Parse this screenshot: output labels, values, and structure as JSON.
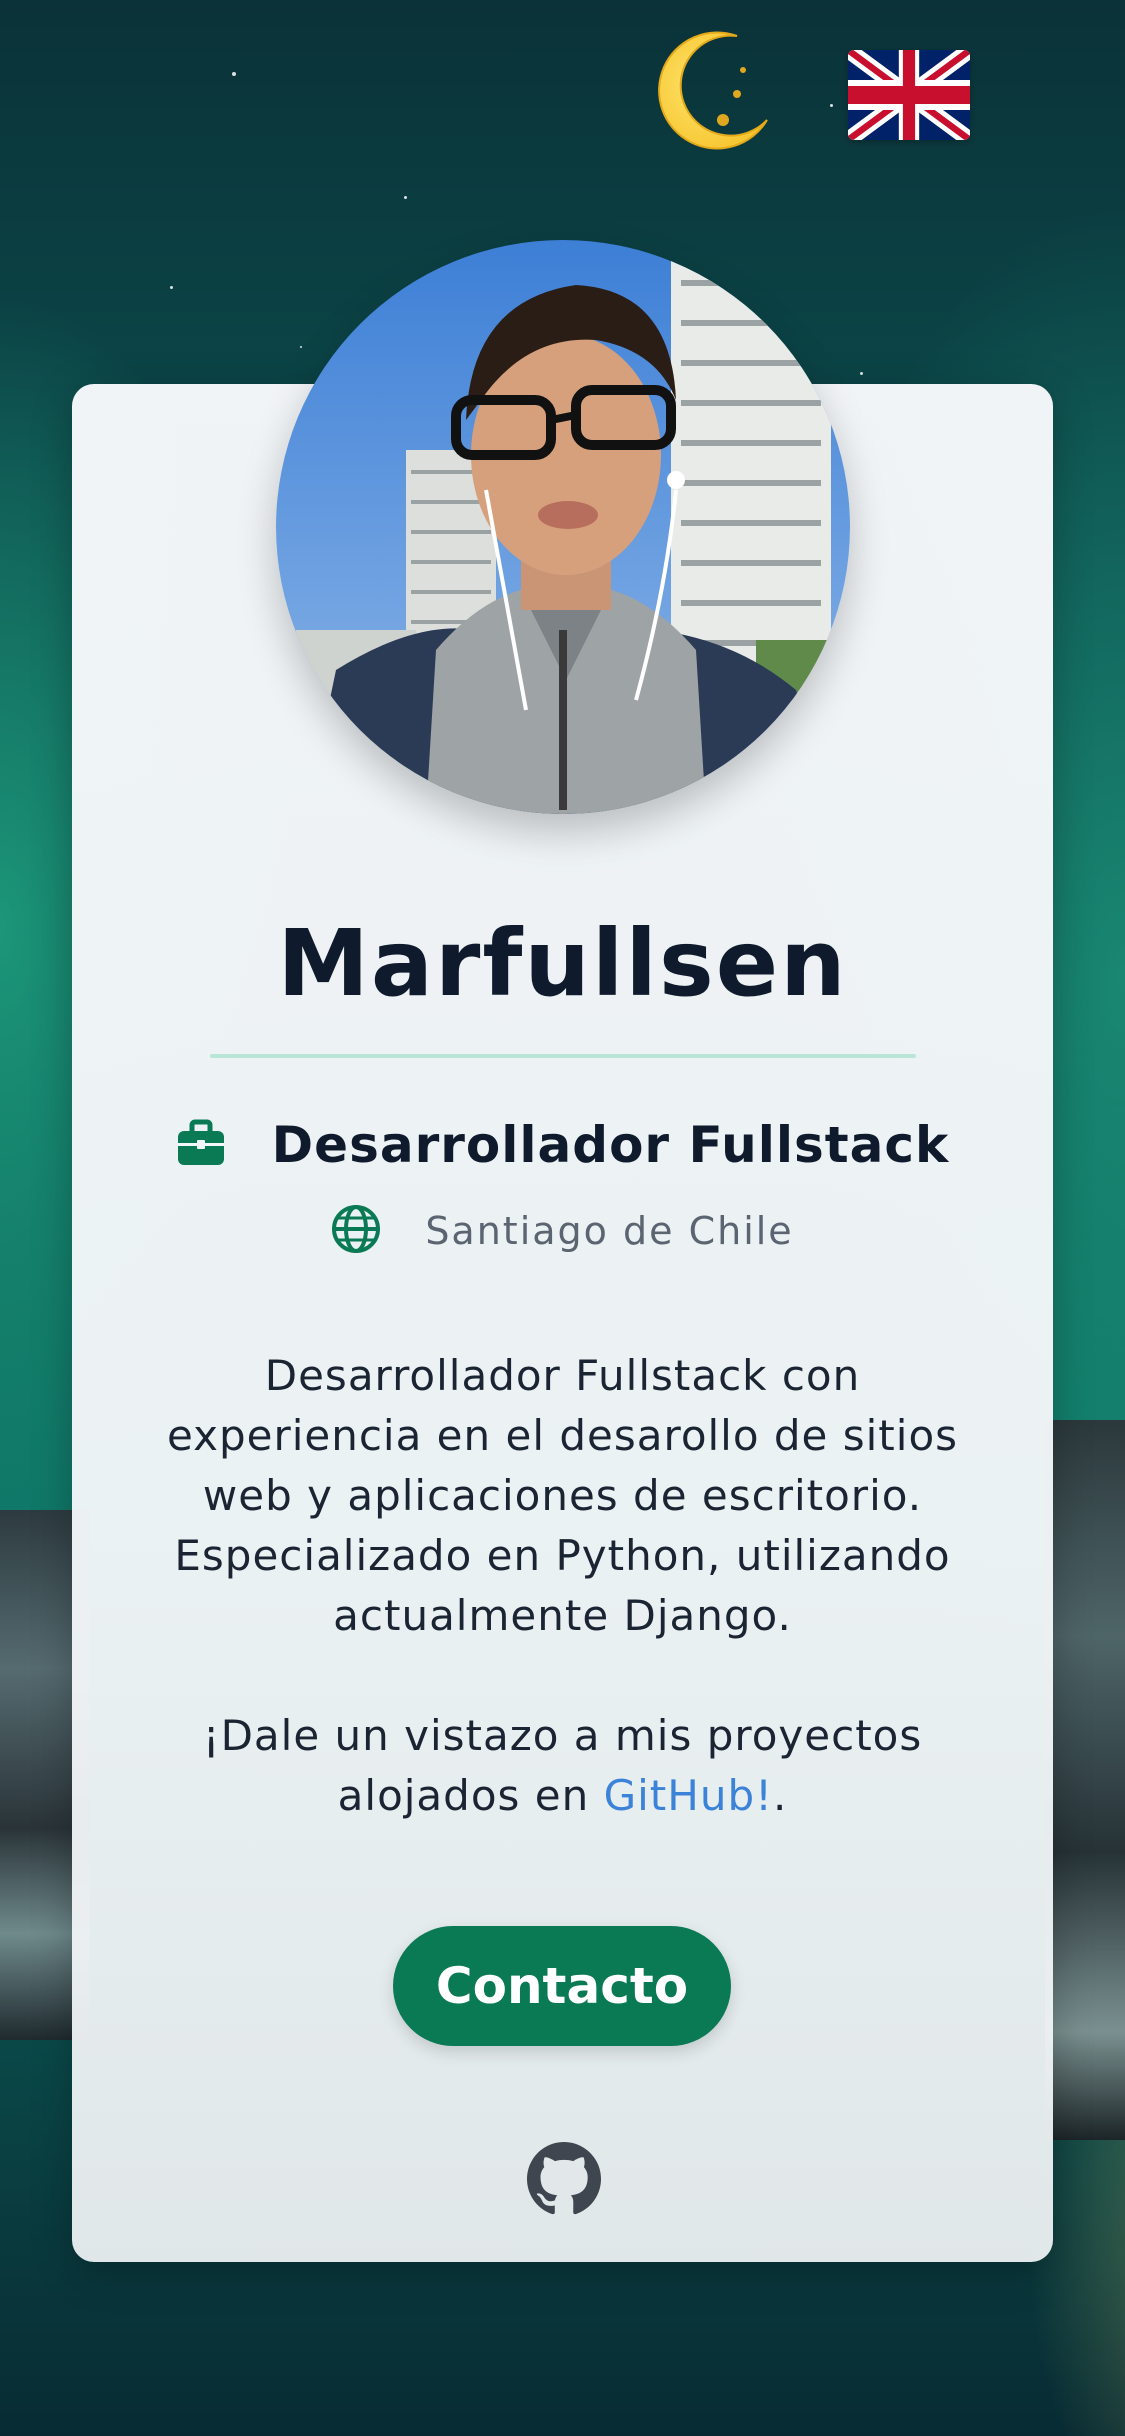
{
  "header": {
    "theme_toggle_icon": "crescent-moon-icon",
    "language_icon": "uk-flag-icon"
  },
  "profile": {
    "name": "Marfullsen",
    "role": "Desarrollador Fullstack",
    "role_icon": "briefcase-icon",
    "location": "Santiago de Chile",
    "location_icon": "globe-icon",
    "bio_paragraph": "Desarrollador Fullstack con experiencia en el desarollo de sitios web y aplicaciones de escritorio. Especializado en Python, utilizando actualmente Django.",
    "cta_prefix": "¡Dale un vistazo a mis proyectos alojados en ",
    "cta_link": "GitHub!",
    "cta_suffix": "."
  },
  "actions": {
    "contact_label": "Contacto",
    "github_icon": "github-icon"
  },
  "colors": {
    "accent": "#0a7a55",
    "link": "#3b82d9",
    "divider": "#b9e6d6",
    "name_text": "#0f1b2d"
  }
}
